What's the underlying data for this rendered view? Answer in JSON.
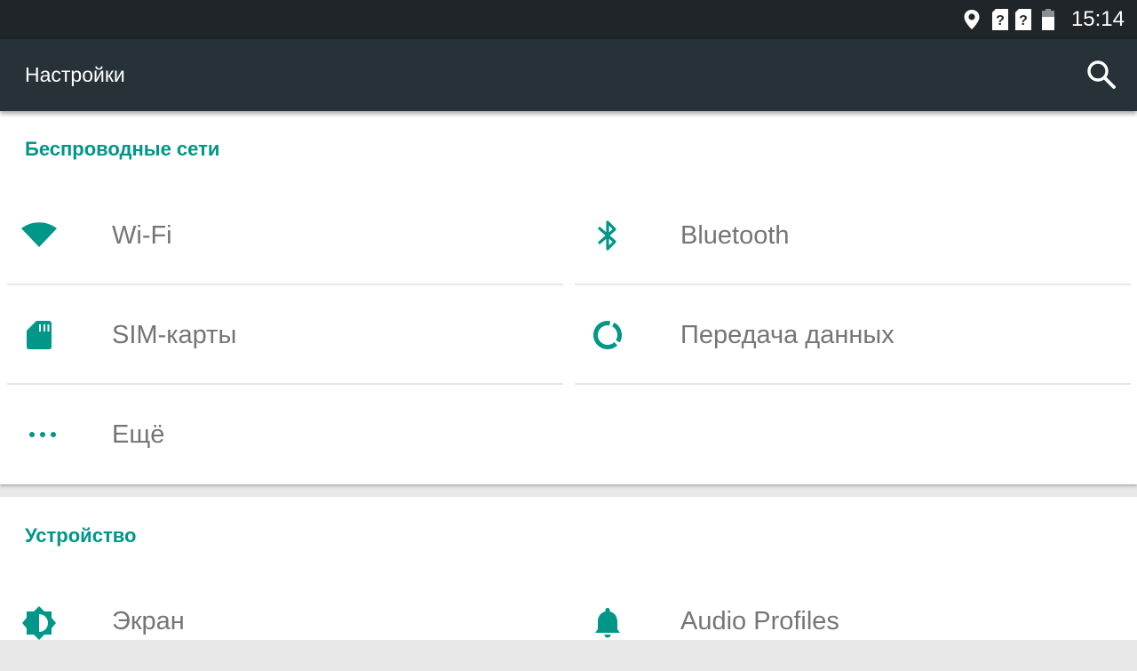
{
  "status_bar": {
    "time": "15:14",
    "icons": [
      "location-icon",
      "sim1-unknown-icon",
      "sim2-unknown-icon",
      "battery-icon"
    ]
  },
  "app_bar": {
    "title": "Настройки",
    "search_icon": "search-icon"
  },
  "colors": {
    "accent": "#009688",
    "app_bar": "#263238",
    "status_bar": "#1f2529",
    "item_text": "#757575"
  },
  "sections": [
    {
      "title": "Беспроводные сети",
      "items": [
        {
          "label": "Wi-Fi",
          "icon": "wifi-icon"
        },
        {
          "label": "Bluetooth",
          "icon": "bluetooth-icon"
        },
        {
          "label": "SIM-карты",
          "icon": "sim-card-icon"
        },
        {
          "label": "Передача данных",
          "icon": "data-usage-icon"
        },
        {
          "label": "Ещё",
          "icon": "more-icon"
        }
      ]
    },
    {
      "title": "Устройство",
      "items": [
        {
          "label": "Экран",
          "icon": "brightness-icon"
        },
        {
          "label": "Audio Profiles",
          "icon": "bell-icon"
        }
      ]
    }
  ]
}
